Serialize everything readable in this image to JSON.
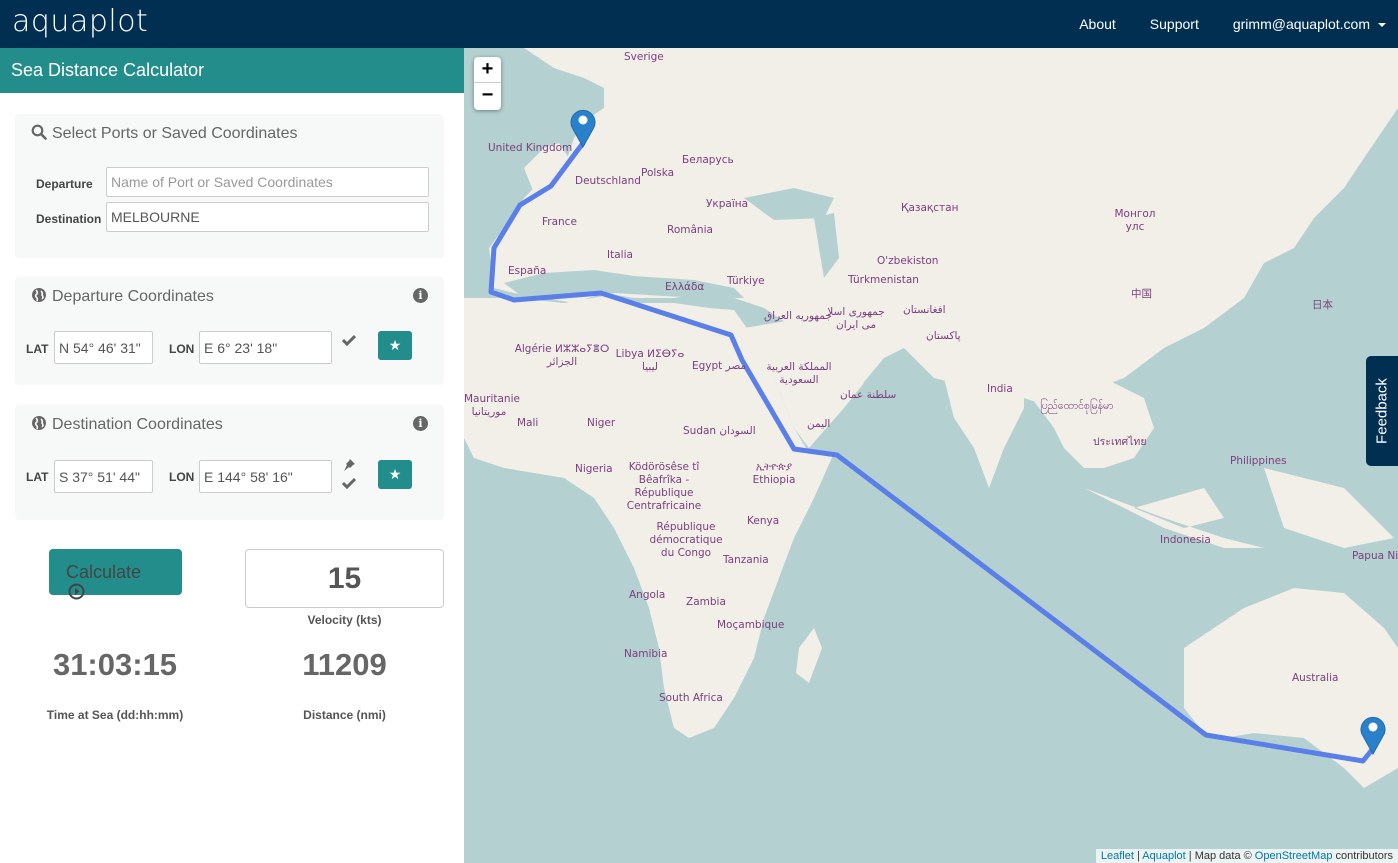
{
  "navbar": {
    "logo": "aquaplot",
    "links": [
      "About",
      "Support"
    ],
    "user": "grimm@aquaplot.com"
  },
  "sidebar": {
    "title": "Sea Distance Calculator",
    "port_select": {
      "title": "Select Ports or Saved Coordinates",
      "departure_label": "Departure",
      "departure_value": "",
      "departure_placeholder": "Name of Port or Saved Coordinates",
      "destination_label": "Destination",
      "destination_value": "MELBOURNE"
    },
    "departure_coords": {
      "title": "Departure Coordinates",
      "lat_label": "LAT",
      "lat": "N 54° 46' 31\"",
      "lon_label": "LON",
      "lon": "E 6° 23' 18\""
    },
    "destination_coords": {
      "title": "Destination Coordinates",
      "lat_label": "LAT",
      "lat": "S 37° 51' 44\"",
      "lon_label": "LON",
      "lon": "E 144° 58' 16\""
    },
    "calculate_label": "Calculate",
    "velocity": "15",
    "velocity_label": "Velocity (kts)",
    "time_at_sea": "31:03:15",
    "time_label": "Time at Sea (dd:hh:mm)",
    "distance": "11209",
    "distance_label": "Distance (nmi)"
  },
  "map": {
    "zoom_in": "+",
    "zoom_out": "−",
    "feedback": "Feedback",
    "route_color": "#5a7fe8",
    "attribution": {
      "leaflet": "Leaflet",
      "aquaplot": "Aquaplot",
      "mapdata": "Map data ©",
      "osm": "OpenStreetMap",
      "contributors": "contributors"
    },
    "labels": [
      "Sverige",
      "United Kingdom",
      "Беларусь",
      "Polska",
      "Deutschland",
      "Україна",
      "France",
      "România",
      "Қазақстан",
      "Монгол улс",
      "España",
      "Italia",
      "O'zbekiston",
      "Türkiye",
      "Türkmenistan",
      "Ελλάδα",
      "جمهوری اسلا می ایران",
      "جمهوریه العراق",
      "افغانستان",
      "中国",
      "日本",
      "پاکستان",
      "Algérie ⵍⵣⵣⴰⵢⴻⵔ الجزائر",
      "Libya ⵍⵉⴱⵢⴰ ليبيا",
      "Egypt مصر",
      "المملكة العربية السعودية",
      "سلطنة عمان",
      "India",
      "ပြည်ထောင်စုမြန်မာ",
      "Mauritanie موريتانيا",
      "Mali",
      "Niger",
      "Sudan السودان",
      "اليمن",
      "ประเทศไทย",
      "Philippines",
      "Nigeria",
      "Ködörösêse tî Bêafrîka - République Centrafricaine",
      "ኢትዮጵያ Ethiopia",
      "Kenya",
      "République démocratique du Congo",
      "Tanzania",
      "Indonesia",
      "Papua Ni",
      "Angola",
      "Zambia",
      "Moçambique",
      "Namibia",
      "South Africa",
      "Australia"
    ]
  }
}
